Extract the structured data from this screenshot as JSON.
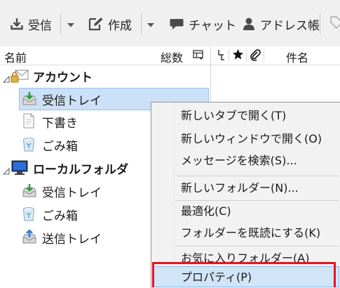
{
  "toolbar": {
    "get_messages": "受信",
    "write": "作成",
    "chat": "チャット",
    "address_book": "アドレス帳"
  },
  "folder_pane": {
    "col_name": "名前",
    "col_count": "総数",
    "folders": [
      {
        "label": "アカウント",
        "icon": "account-icon"
      },
      {
        "label": "受信トレイ",
        "icon": "inbox-icon"
      },
      {
        "label": "下書き",
        "icon": "drafts-icon"
      },
      {
        "label": "ごみ箱",
        "icon": "trash-icon"
      },
      {
        "label": "ローカルフォルダ",
        "icon": "local-folders-icon"
      },
      {
        "label": "受信トレイ",
        "icon": "inbox-icon"
      },
      {
        "label": "ごみ箱",
        "icon": "trash-icon"
      },
      {
        "label": "送信トレイ",
        "icon": "outbox-icon"
      }
    ]
  },
  "message_list": {
    "col_subject": "件名"
  },
  "context_menu": {
    "open_new_tab": "新しいタブで開く(T)",
    "open_new_window": "新しいウィンドウで開く(O)",
    "search_messages": "メッセージを検索(S)...",
    "new_folder": "新しいフォルダー(N)...",
    "compact": "最適化(C)",
    "mark_folder_read": "フォルダーを既読にする(K)",
    "favorite_folder": "お気に入りフォルダー(A)",
    "properties": "プロパティ(P)"
  },
  "colors": {
    "selection": "#cce0f7",
    "menu_highlight": "#d1e4f8",
    "annotation_red": "#e8141c"
  }
}
